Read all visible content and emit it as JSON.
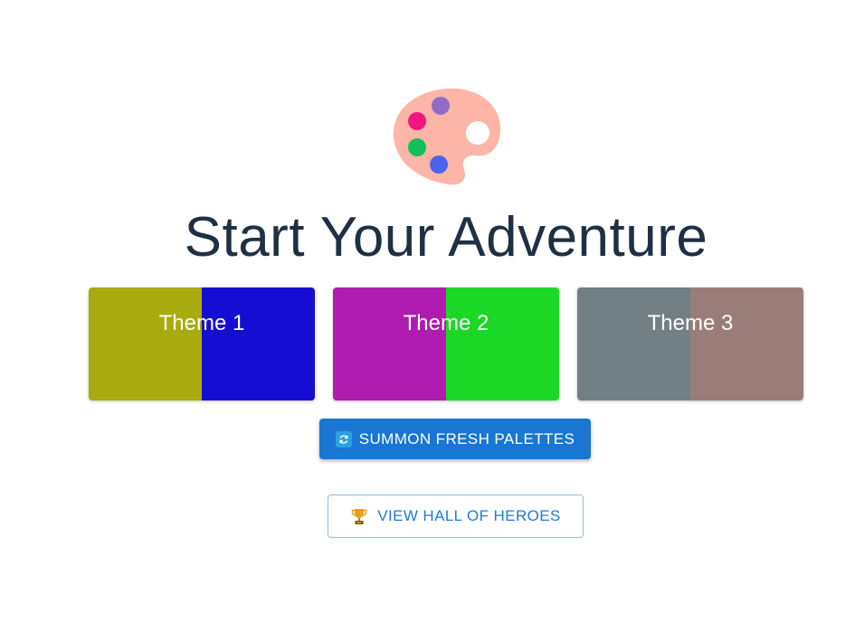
{
  "hero": {
    "logo_icon": "artist-palette-icon",
    "title": "Start Your Adventure"
  },
  "themes": [
    {
      "label": "Theme 1",
      "colors": [
        "#a8ab10",
        "#150dd1"
      ]
    },
    {
      "label": "Theme 2",
      "colors": [
        "#b01caf",
        "#1bd826"
      ]
    },
    {
      "label": "Theme 3",
      "colors": [
        "#727f85",
        "#9a7d78"
      ]
    }
  ],
  "actions": {
    "summon": {
      "label": "SUMMON FRESH PALETTES",
      "icon": "refresh-icon",
      "color": "#1976d2"
    },
    "hall": {
      "label": "VIEW HALL OF HEROES",
      "icon": "trophy-icon",
      "color": "#1e7bd6"
    }
  }
}
